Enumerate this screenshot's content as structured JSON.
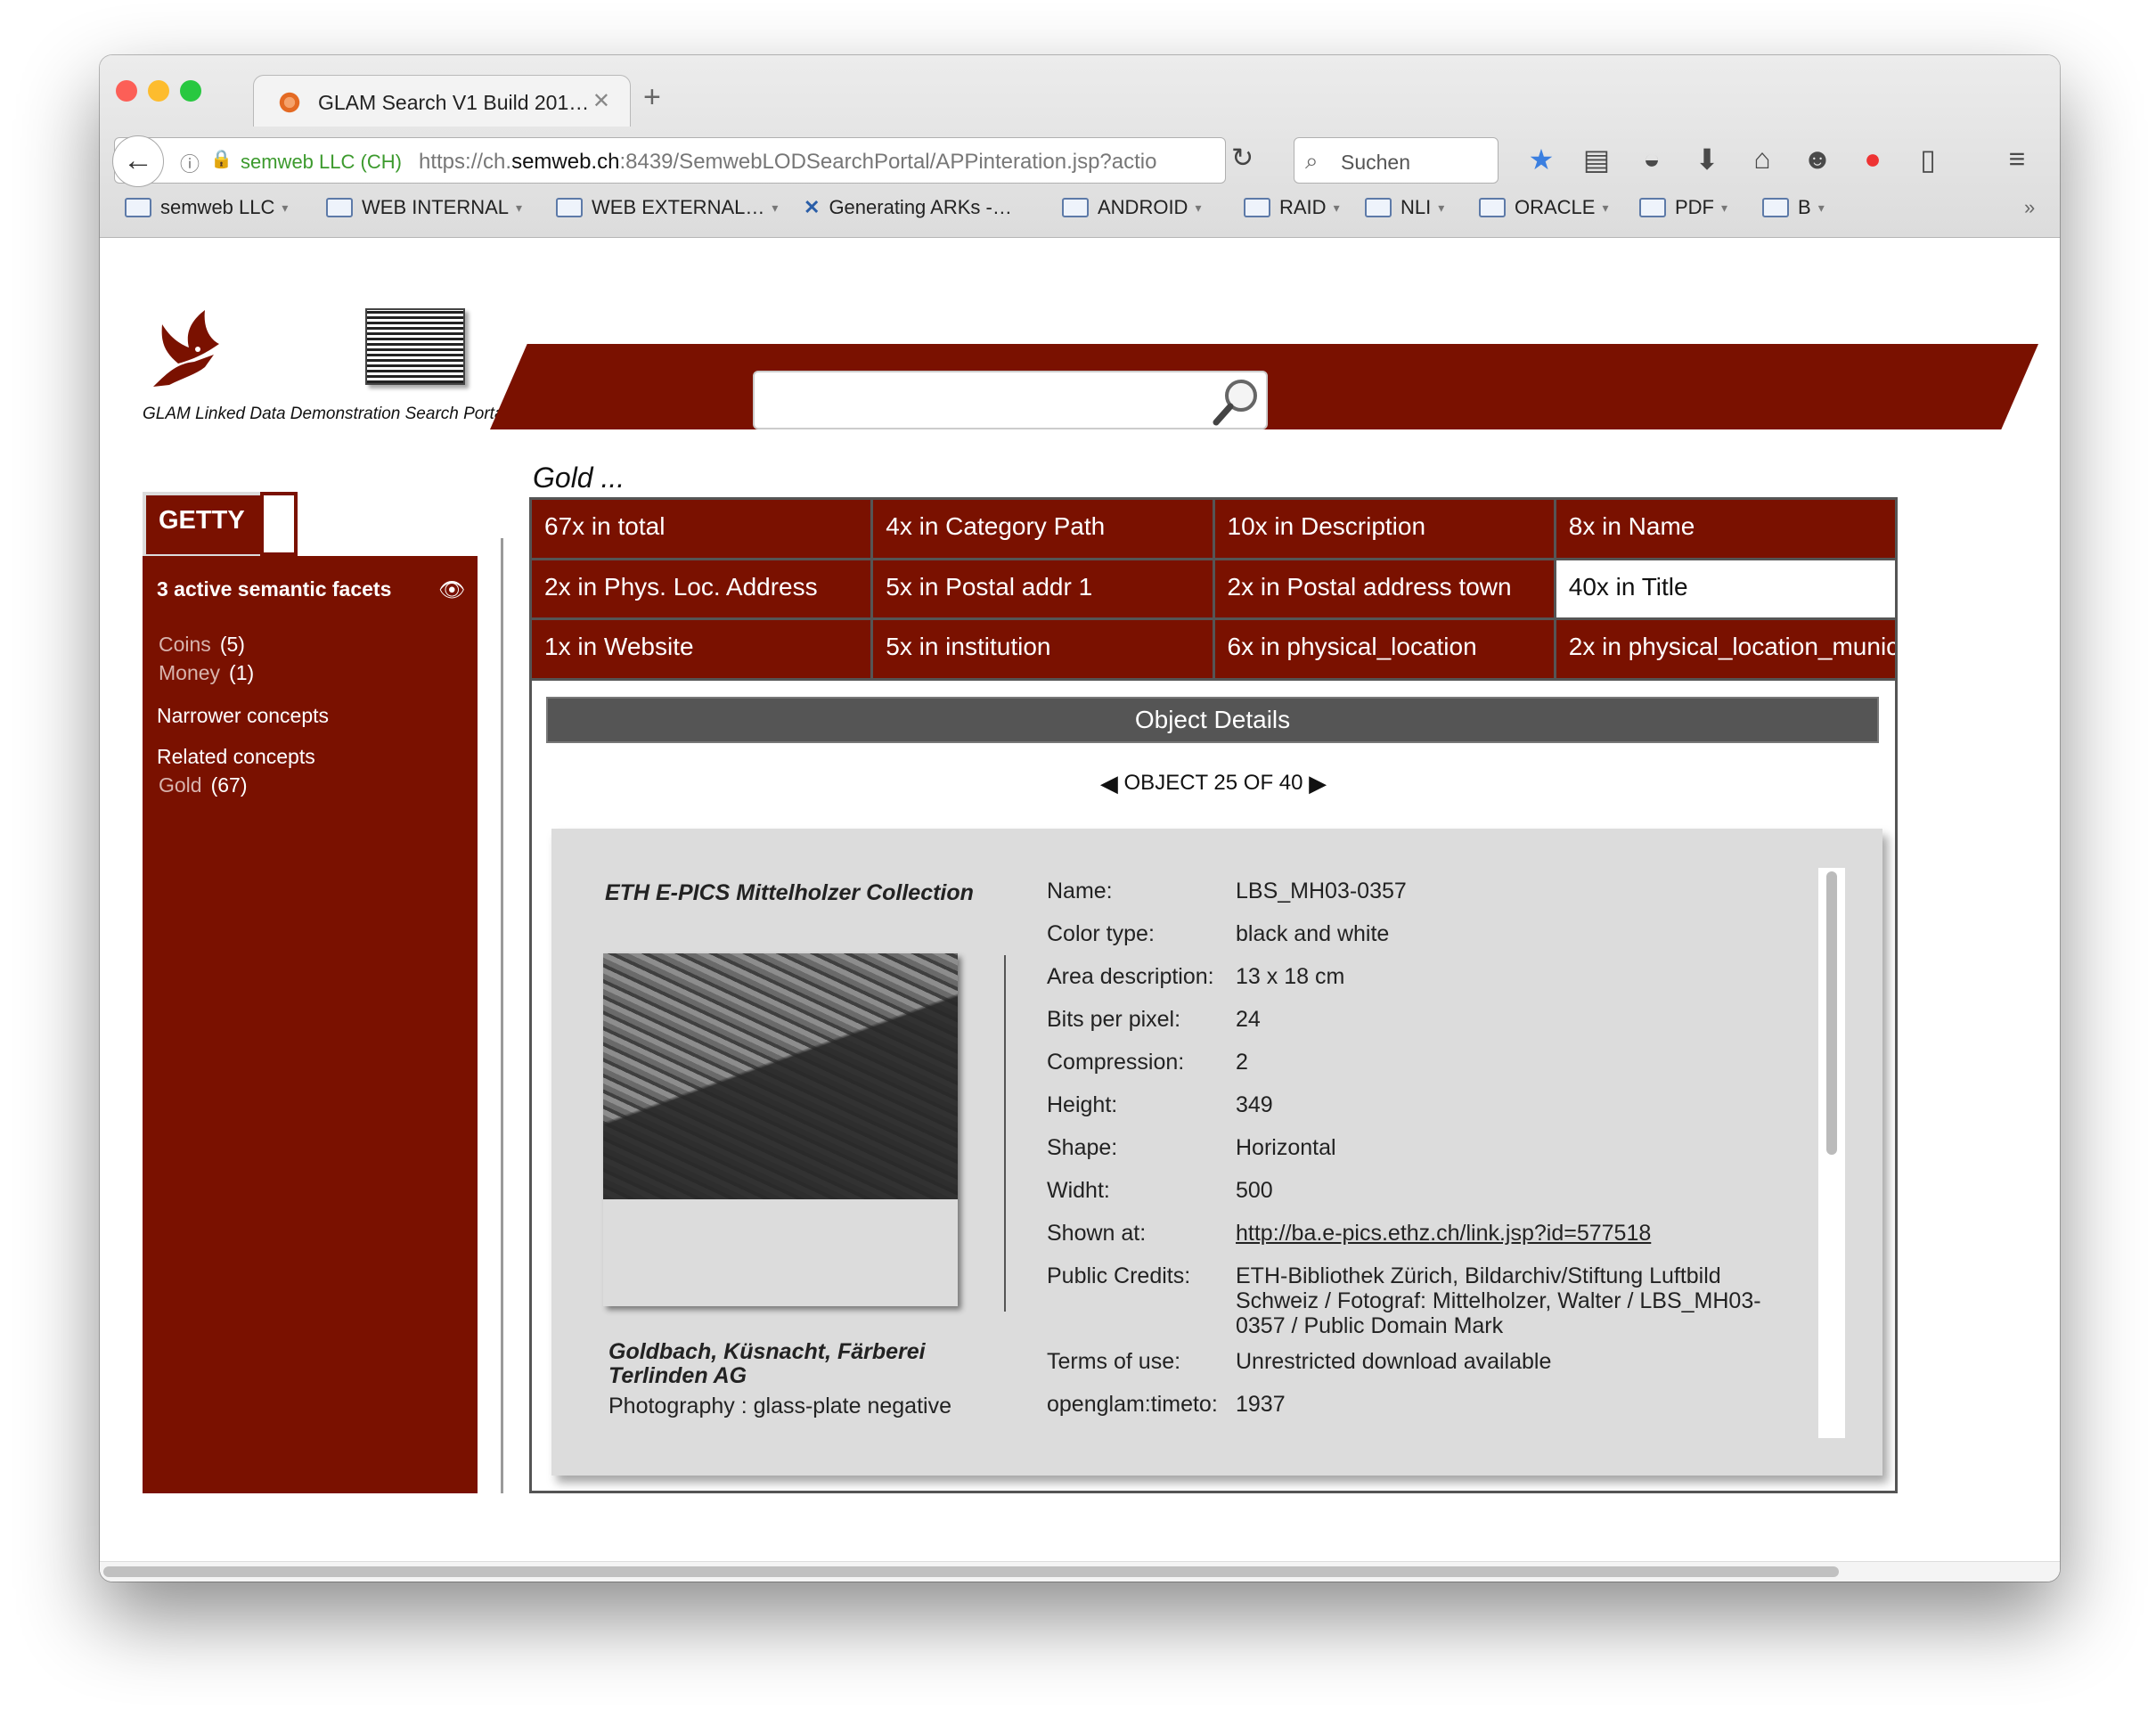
{
  "browser": {
    "tab_title": "GLAM Search V1 Build 201…",
    "site_identity": "semweb LLC (CH)",
    "url_prefix": "https://ch.",
    "url_domain": "semweb.ch",
    "url_rest": ":8439/SemwebLODSearchPortal/APPinteration.jsp?actio",
    "search_placeholder": "Suchen",
    "bookmarks": [
      "semweb LLC",
      "WEB INTERNAL",
      "WEB EXTERNAL…",
      "Generating ARKs -…",
      "ANDROID",
      "RAID",
      "NLI",
      "ORACLE",
      "PDF",
      "B"
    ]
  },
  "header": {
    "tagline": "GLAM Linked Data Demonstration Search Portal",
    "search_value": ""
  },
  "query": "Gold ...",
  "sidebar": {
    "tab_label": "GETTY",
    "facets_title": "3 active semantic facets",
    "facets": [
      {
        "label": "Coins",
        "count": "(5)"
      },
      {
        "label": "Money",
        "count": "(1)"
      }
    ],
    "narrower": "Narrower concepts",
    "related": "Related concepts",
    "related_items": [
      {
        "label": "Gold",
        "count": "(67)"
      }
    ]
  },
  "hits": [
    "67x in total",
    "4x in Category Path",
    "10x in Description",
    "8x in Name",
    "2x in Phys. Loc. Address",
    "5x in Postal addr 1",
    "2x in Postal address town",
    "40x in Title",
    "1x in Website",
    "5x in institution",
    "6x in physical_location",
    "2x in physical_location_munic"
  ],
  "details": {
    "header": "Object Details",
    "nav_text": "OBJECT 25 OF 40",
    "collection": "ETH E-PICS Mittelholzer Collection",
    "image_title": "Goldbach, Küsnacht, Färberei Terlinden AG",
    "image_subtitle": "Photography : glass-plate negative",
    "fields": [
      {
        "k": "Name:",
        "v": "LBS_MH03-0357"
      },
      {
        "k": "Color type:",
        "v": "black and white"
      },
      {
        "k": "Area description:",
        "v": "13 x 18 cm"
      },
      {
        "k": "Bits per pixel:",
        "v": "24"
      },
      {
        "k": "Compression:",
        "v": "2"
      },
      {
        "k": "Height:",
        "v": "349"
      },
      {
        "k": "Shape:",
        "v": "Horizontal"
      },
      {
        "k": "Widht:",
        "v": "500"
      },
      {
        "k": "Shown at:",
        "v": "http://ba.e-pics.ethz.ch/link.jsp?id=577518"
      },
      {
        "k": "Public Credits:",
        "v": "ETH-Bibliothek Zürich, Bildarchiv/Stiftung Luftbild Schweiz / Fotograf: Mittelholzer, Walter / LBS_MH03-0357 / Public Domain Mark"
      },
      {
        "k": "Terms of use:",
        "v": "Unrestricted download available"
      },
      {
        "k": "openglam:timeto:",
        "v": "1937"
      }
    ]
  },
  "colors": {
    "brand": "#7a1100",
    "panel": "#dcdcdc",
    "header_bar": "#555555"
  }
}
